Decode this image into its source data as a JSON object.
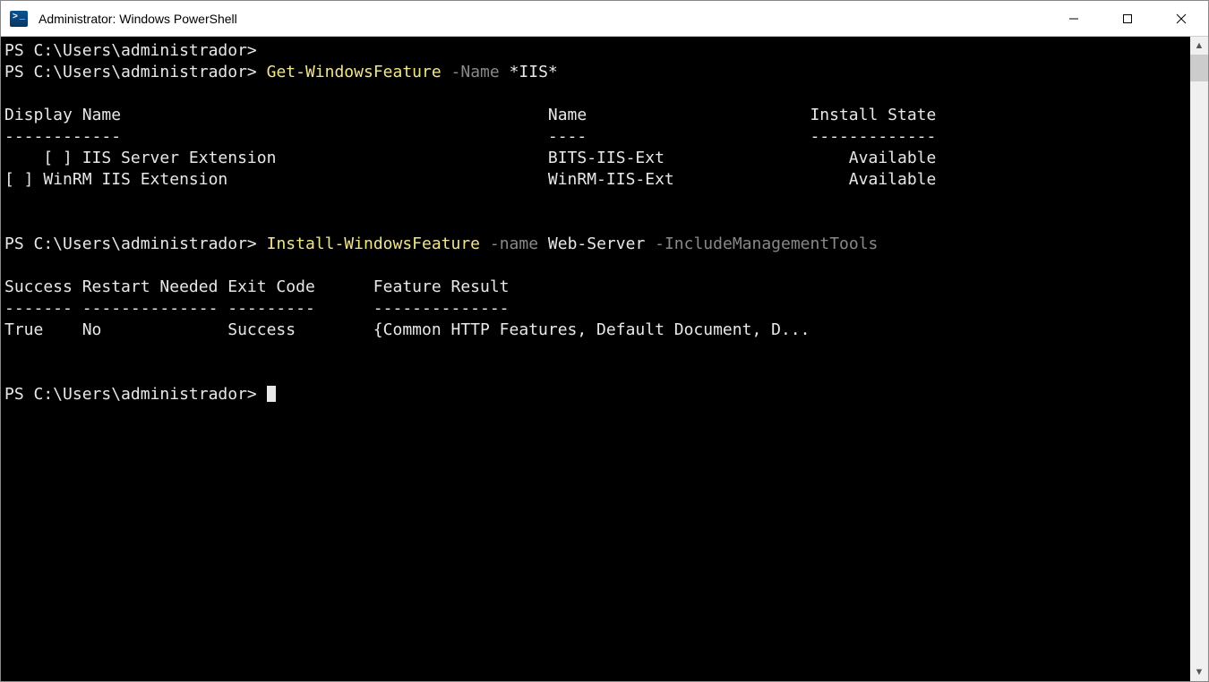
{
  "window": {
    "title": "Administrator: Windows PowerShell"
  },
  "ps": {
    "prompt": "PS C:\\Users\\administrador>",
    "cmd1": {
      "cmdlet": "Get-WindowsFeature",
      "param": "-Name",
      "arg": "*IIS*"
    },
    "table1": {
      "header_line": "Display Name                                            Name                       Install State",
      "divider_line": "------------                                            ----                       -------------",
      "row1": "    [ ] IIS Server Extension                            BITS-IIS-Ext                   Available",
      "row2": "[ ] WinRM IIS Extension                                 WinRM-IIS-Ext                  Available"
    },
    "cmd2": {
      "cmdlet": "Install-WindowsFeature",
      "param": "-name",
      "arg": "Web-Server",
      "switch": "-IncludeManagementTools"
    },
    "table2": {
      "header_line": "Success Restart Needed Exit Code      Feature Result",
      "divider_line": "------- -------------- ---------      --------------",
      "row1": "True    No             Success        {Common HTTP Features, Default Document, D..."
    }
  }
}
